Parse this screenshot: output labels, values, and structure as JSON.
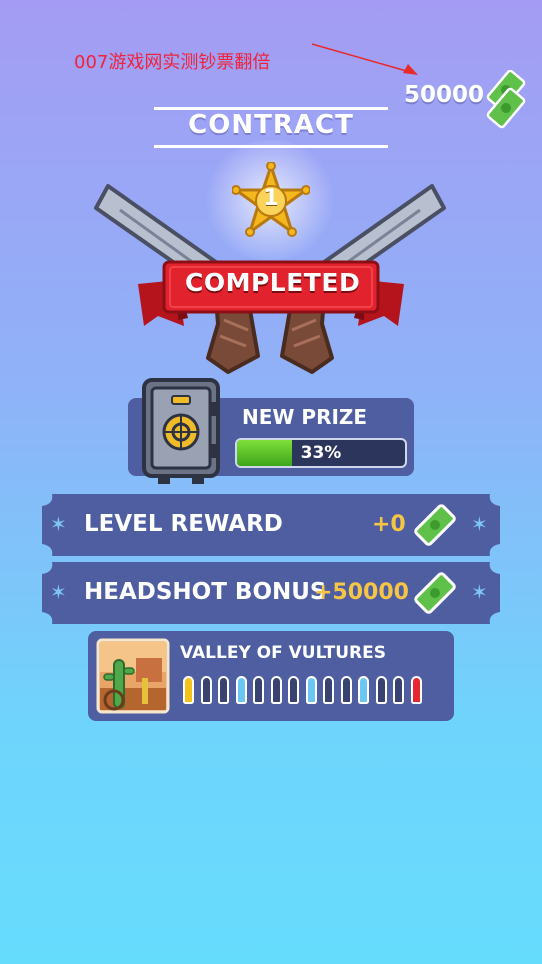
{
  "watermark": {
    "text": "007游戏网实测钞票翻倍"
  },
  "header": {
    "currency_amount": "50000"
  },
  "title": {
    "text": "CONTRACT"
  },
  "badge": {
    "number": "1"
  },
  "banner": {
    "text": "COMPLETED"
  },
  "prize": {
    "label": "NEW PRIZE",
    "progress_label": "33%",
    "progress": 0.33
  },
  "rewards": [
    {
      "label": "LEVEL REWARD",
      "value": "+0"
    },
    {
      "label": "HEADSHOT BONUS",
      "value": "+50000"
    }
  ],
  "level": {
    "name": "VALLEY OF VULTURES",
    "bullet_colors": [
      "#f5c21b",
      "#3a4270",
      "#3a4270",
      "#6cc6f2",
      "#3a4270",
      "#3a4270",
      "#3a4270",
      "#6cc6f2",
      "#3a4270",
      "#3a4270",
      "#6cc6f2",
      "#3a4270",
      "#3a4270",
      "#e8262f"
    ]
  },
  "colors": {
    "accent_gold": "#f6c545",
    "banner_red": "#e2222c",
    "panel": "#4e5ea0",
    "progress_green": "#5cc42a"
  }
}
